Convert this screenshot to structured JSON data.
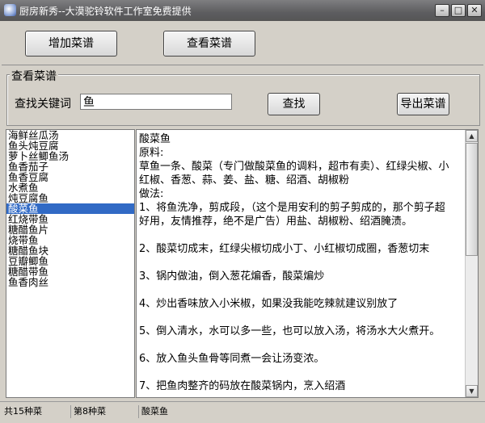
{
  "window": {
    "title": "厨房新秀--大漠驼铃软件工作室免费提供"
  },
  "toolbar": {
    "add_recipe": "增加菜谱",
    "view_recipe": "查看菜谱"
  },
  "search_group": {
    "legend": "查看菜谱",
    "keyword_label": "查找关键词",
    "keyword_value": "鱼",
    "search_button": "查找",
    "export_button": "导出菜谱"
  },
  "recipe_list": [
    "海鲜丝瓜汤",
    "鱼头炖豆腐",
    "萝卜丝鲫鱼汤",
    "鱼香茄子",
    "鱼香豆腐",
    "水煮鱼",
    "炖豆腐鱼",
    "酸菜鱼",
    "红烧带鱼",
    "糖醋鱼片",
    "烧带鱼",
    "糖醋鱼块",
    "豆瓣鲫鱼",
    "糖醋带鱼",
    "鱼香肉丝"
  ],
  "selected_index": 7,
  "recipe_text": [
    "酸菜鱼",
    "原料:",
    "草鱼一条、酸菜（专门做酸菜鱼的调料，超市有卖）、红绿尖椒、小",
    "红椒、香葱、蒜、姜、盐、糖、绍酒、胡椒粉",
    "做法:",
    "1、将鱼洗净，剪成段，（这个是用安利的剪子剪成的，那个剪子超",
    "好用，友情推荐，绝不是广告）用盐、胡椒粉、绍酒腌渍。",
    "",
    "2、酸菜切成末，红绿尖椒切成小丁、小红椒切成圈，香葱切末",
    "",
    "3、锅内做油，倒入葱花煸香，酸菜煸炒",
    "",
    "4、炒出香味放入小米椒，如果没我能吃辣就建议别放了",
    "",
    "5、倒入清水，水可以多一些，也可以放入汤，将汤水大火煮开。",
    "",
    "6、放入鱼头鱼骨等同煮一会让汤变浓。",
    "",
    "7、把鱼肉整齐的码放在酸菜锅内，烹入绍酒"
  ],
  "status": {
    "total": "共15种菜",
    "index": "第8种菜",
    "current": "酸菜鱼"
  },
  "icons": {
    "app": "app-icon",
    "minimize": "minimize-icon",
    "maximize": "maximize-icon",
    "close": "close-icon"
  }
}
